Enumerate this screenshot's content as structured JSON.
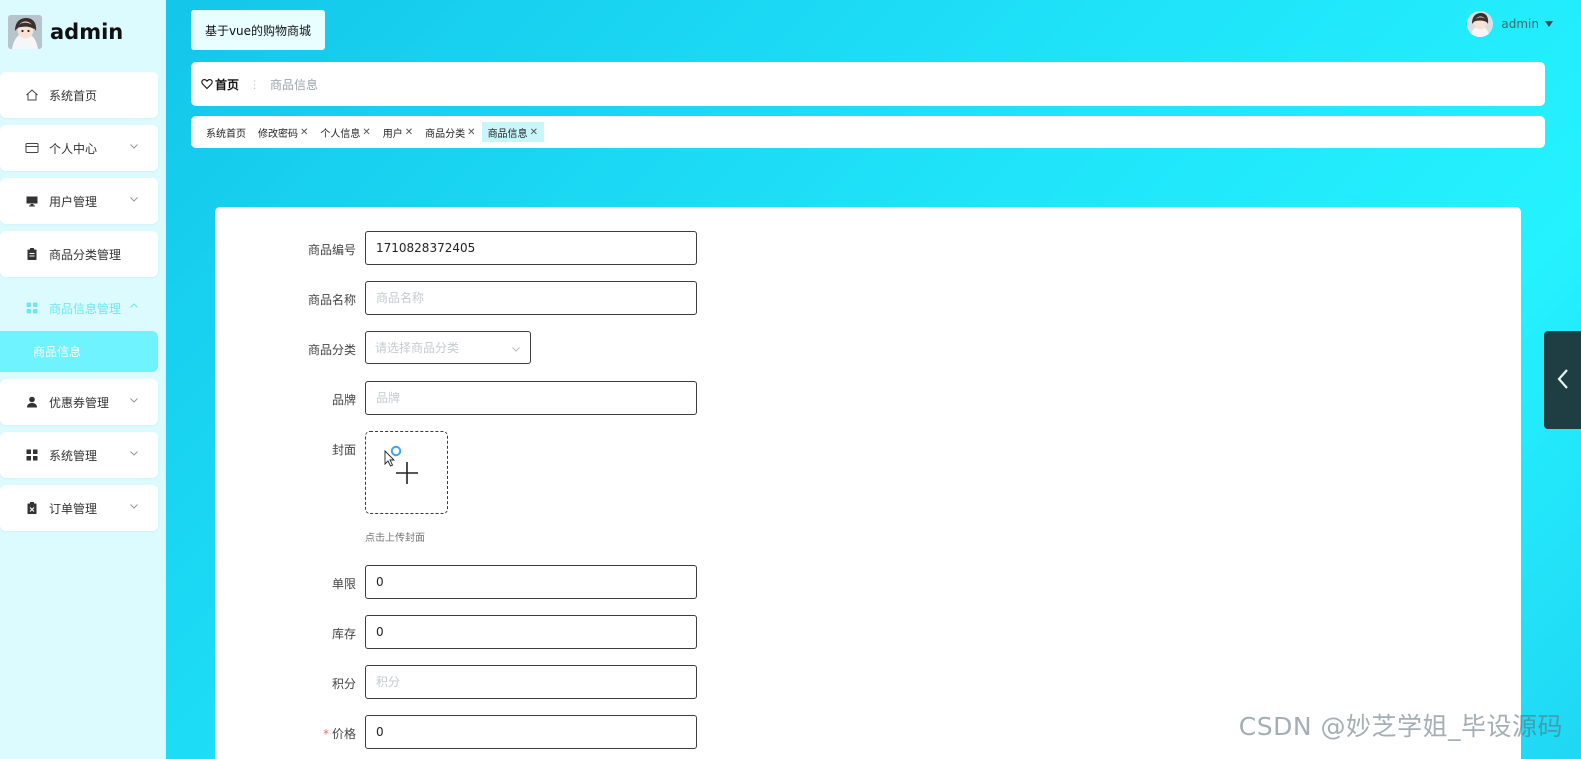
{
  "brand": {
    "title": "admin"
  },
  "sidebar": {
    "items": [
      {
        "label": "系统首页",
        "icon": "home-icon"
      },
      {
        "label": "个人中心",
        "icon": "card-icon"
      },
      {
        "label": "用户管理",
        "icon": "monitor-icon"
      },
      {
        "label": "商品分类管理",
        "icon": "clipboard-icon"
      },
      {
        "label": "商品信息管理",
        "icon": "grid-icon"
      },
      {
        "label": "优惠券管理",
        "icon": "person-icon"
      },
      {
        "label": "系统管理",
        "icon": "apps-icon"
      },
      {
        "label": "订单管理",
        "icon": "trash-clipboard-icon"
      }
    ],
    "sub_item": {
      "label": "商品信息"
    }
  },
  "header": {
    "site_title": "基于vue的购物商城",
    "user_name": "admin"
  },
  "breadcrumb": {
    "home": "首页",
    "separator": "⋮",
    "current": "商品信息"
  },
  "tabs": [
    {
      "label": "系统首页",
      "closable": false
    },
    {
      "label": "修改密码",
      "closable": true
    },
    {
      "label": "个人信息",
      "closable": true
    },
    {
      "label": "用户",
      "closable": true
    },
    {
      "label": "商品分类",
      "closable": true
    },
    {
      "label": "商品信息",
      "closable": true
    }
  ],
  "form": {
    "code": {
      "label": "商品编号",
      "value": "1710828372405"
    },
    "name": {
      "label": "商品名称",
      "placeholder": "商品名称"
    },
    "category": {
      "label": "商品分类",
      "placeholder": "请选择商品分类"
    },
    "brand": {
      "label": "品牌",
      "placeholder": "品牌"
    },
    "cover": {
      "label": "封面",
      "tip": "点击上传封面"
    },
    "limit": {
      "label": "单限",
      "value": "0"
    },
    "stock": {
      "label": "库存",
      "value": "0"
    },
    "points": {
      "label": "积分",
      "placeholder": "积分"
    },
    "price": {
      "label": "价格",
      "required_mark": "*",
      "value": "0"
    }
  },
  "watermark": "CSDN @妙芝学姐_毕设源码",
  "colors": {
    "accent": "#6ff3ff",
    "sidebar_bg": "#dcfbff",
    "toggle_bg": "#1f3e44"
  }
}
